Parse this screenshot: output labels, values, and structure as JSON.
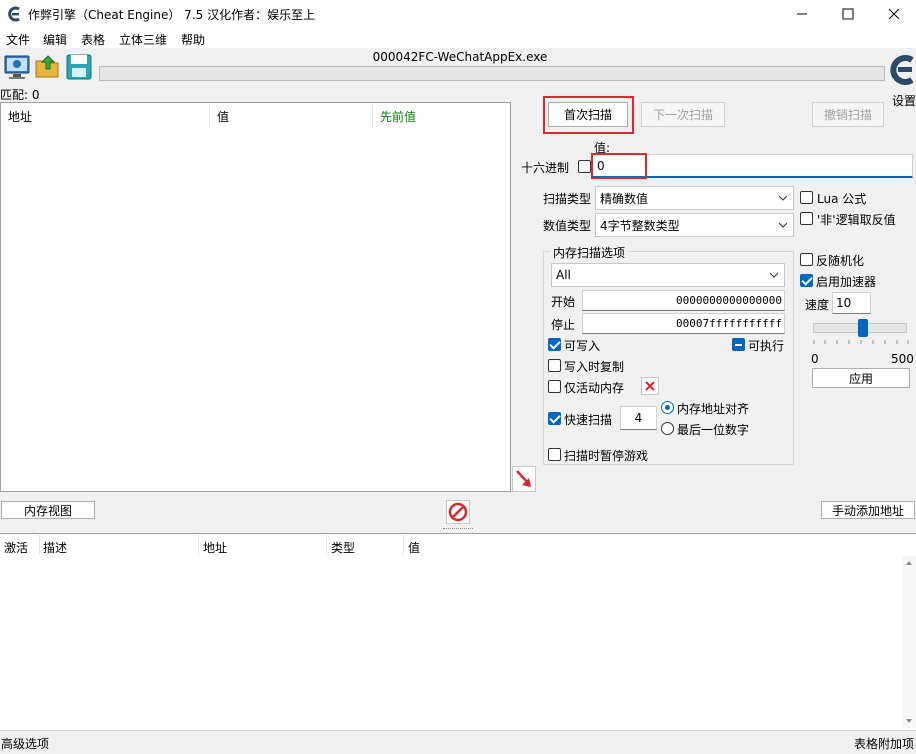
{
  "window": {
    "title": "作弊引擎（Cheat Engine） 7.5 汉化作者：娱乐至上",
    "icon": "cheat-engine-icon",
    "controls": [
      "minimize-icon",
      "maximize-icon",
      "close-icon"
    ]
  },
  "menu": {
    "items": [
      "文件",
      "编辑",
      "表格",
      "立体三维",
      "帮助"
    ]
  },
  "toolbar": {
    "process_title": "000042FC-WeChatAppEx.exe",
    "icons": [
      "open-process-icon",
      "open-file-icon",
      "save-icon"
    ],
    "settings_label": "设置",
    "progress": 0
  },
  "results": {
    "match_label": "匹配: 0",
    "columns": [
      "地址",
      "值",
      "先前值"
    ],
    "rows": []
  },
  "scan": {
    "first_scan": "首次扫描",
    "next_scan": "下一次扫描",
    "undo_scan": "撤销扫描",
    "value_label": "值:",
    "hex_label": "十六进制",
    "value_input": "0",
    "scan_type_label": "扫描类型",
    "scan_type_value": "精确数值",
    "value_type_label": "数值类型",
    "value_type_value": "4字节整数类型",
    "lua_formula": "Lua 公式",
    "not_logic": "'非'逻辑取反值",
    "memory_group_label": "内存扫描选项",
    "memory_region": "All",
    "start_label": "开始",
    "start_value": "0000000000000000",
    "stop_label": "停止",
    "stop_value": "00007fffffffffff",
    "writable": "可写入",
    "executable": "可执行",
    "copy_on_write": "写入时复制",
    "active_memory_only": "仅活动内存",
    "fast_scan": "快速扫描",
    "fast_scan_value": "4",
    "align_memory": "内存地址对齐",
    "last_digit": "最后一位数字",
    "pause_game": "扫描时暂停游戏",
    "unrandomizer": "反随机化",
    "speedhack": "启用加速器",
    "speed_label": "速度",
    "speed_value": "10",
    "slider_min": "0",
    "slider_max": "500",
    "apply": "应用"
  },
  "bottom": {
    "memory_view": "内存视图",
    "add_address": "手动添加地址",
    "columns": [
      "激活",
      "描述",
      "地址",
      "类型",
      "值"
    ]
  },
  "status": {
    "left": "高级选项",
    "right": "表格附加项"
  }
}
